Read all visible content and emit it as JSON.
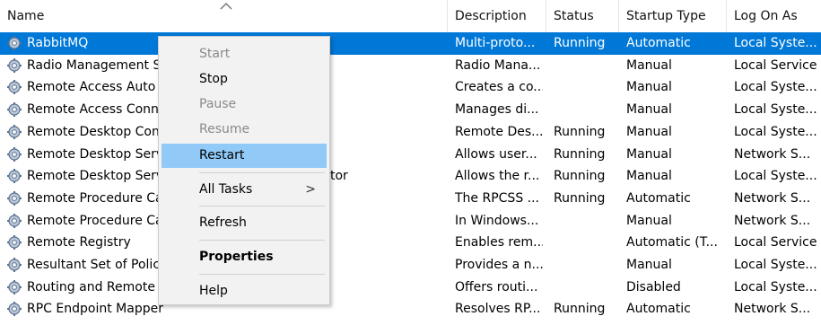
{
  "columns": {
    "name": "Name",
    "description": "Description",
    "status": "Status",
    "startup_type": "Startup Type",
    "log_on_as": "Log On As"
  },
  "rows": [
    {
      "name": "RabbitMQ",
      "description": "Multi-proto...",
      "status": "Running",
      "startup": "Automatic",
      "logon": "Local Syste...",
      "selected": true
    },
    {
      "name": "Radio Management S",
      "description": "Radio Mana...",
      "status": "",
      "startup": "Manual",
      "logon": "Local Service"
    },
    {
      "name": "Remote Access Auto",
      "description": "Creates a co...",
      "status": "",
      "startup": "Manual",
      "logon": "Local Syste..."
    },
    {
      "name": "Remote Access Conn",
      "description": "Manages di...",
      "status": "",
      "startup": "Manual",
      "logon": "Local Syste..."
    },
    {
      "name": "Remote Desktop Con",
      "description": "Remote Des...",
      "status": "Running",
      "startup": "Manual",
      "logon": "Local Syste..."
    },
    {
      "name": "Remote Desktop Serv",
      "description": "Allows user...",
      "status": "Running",
      "startup": "Manual",
      "logon": "Network S..."
    },
    {
      "name": "Remote Desktop Serv",
      "description": "Allows the r...",
      "status": "Running",
      "startup": "Manual",
      "logon": "Local Syste...",
      "trailing": "tor"
    },
    {
      "name": "Remote Procedure Ca",
      "description": "The RPCSS ...",
      "status": "Running",
      "startup": "Automatic",
      "logon": "Network S..."
    },
    {
      "name": "Remote Procedure Ca",
      "description": "In Windows...",
      "status": "",
      "startup": "Manual",
      "logon": "Network S..."
    },
    {
      "name": "Remote Registry",
      "description": "Enables rem...",
      "status": "",
      "startup": "Automatic (T...",
      "logon": "Local Service"
    },
    {
      "name": "Resultant Set of Polic",
      "description": "Provides a n...",
      "status": "",
      "startup": "Manual",
      "logon": "Local Syste..."
    },
    {
      "name": "Routing and Remote",
      "description": "Offers routi...",
      "status": "",
      "startup": "Disabled",
      "logon": "Local Syste..."
    },
    {
      "name": "RPC Endpoint Mapper",
      "description": "Resolves RP...",
      "status": "Running",
      "startup": "Automatic",
      "logon": "Network S..."
    }
  ],
  "context_menu": {
    "start": "Start",
    "stop": "Stop",
    "pause": "Pause",
    "resume": "Resume",
    "restart": "Restart",
    "all_tasks": "All Tasks",
    "all_tasks_arrow": ">",
    "refresh": "Refresh",
    "properties": "Properties",
    "help": "Help"
  },
  "colors": {
    "selection": "#0078d7",
    "menu_hover": "#91c9f7",
    "menu_background": "#f2f2f2",
    "disabled_text": "#8a8a8a"
  },
  "icons": {
    "service": "gear-icon",
    "sort": "sort-ascending-icon",
    "submenu": "chevron-right-icon"
  }
}
